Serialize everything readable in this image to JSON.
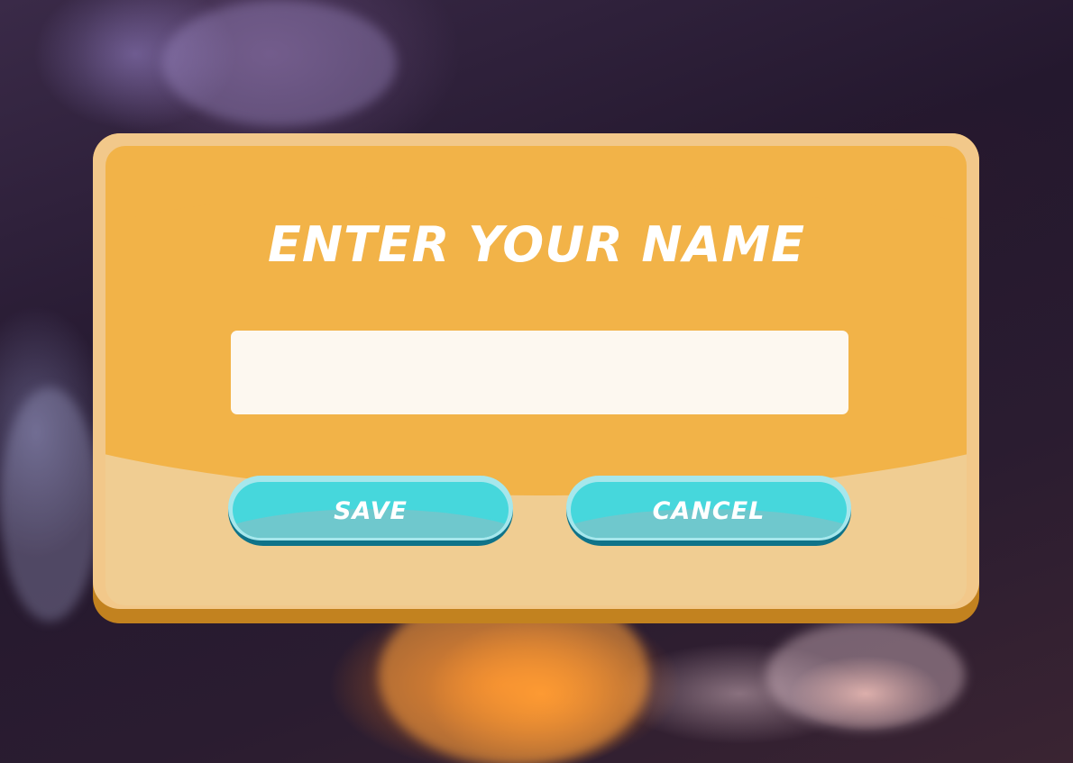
{
  "dialog": {
    "title": "ENTER YOUR NAME",
    "name_input": {
      "value": "",
      "placeholder": ""
    },
    "buttons": {
      "save_label": "SAVE",
      "cancel_label": "CANCEL"
    }
  },
  "colors": {
    "panel_top": "#f2b348",
    "panel_bottom": "#f0cd92",
    "panel_shadow": "#c2821f",
    "button_face": "#46d7dc",
    "button_shadow": "#0f7389",
    "text": "#ffffff"
  }
}
